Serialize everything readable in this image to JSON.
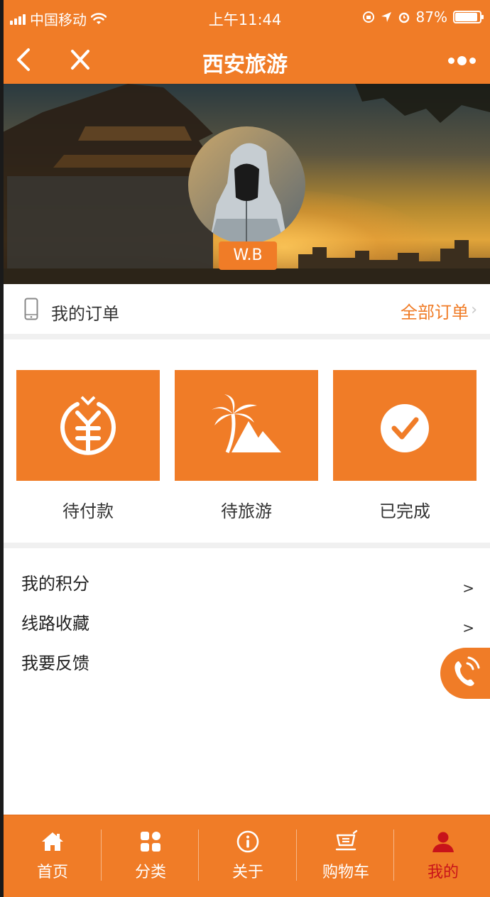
{
  "status_bar": {
    "carrier": "中国移动",
    "time": "上午11:44",
    "battery": "87%"
  },
  "nav": {
    "title": "西安旅游",
    "back_icon": "chevron-left-icon",
    "close_icon": "close-icon",
    "more_icon": "more-dots-icon"
  },
  "profile": {
    "username": "W.B"
  },
  "orders": {
    "label": "我的订单",
    "all_orders": "全部订单",
    "chevron": "›"
  },
  "order_status": [
    {
      "label": "待付款",
      "icon": "yuan-coin-icon"
    },
    {
      "label": "待旅游",
      "icon": "palm-tree-icon"
    },
    {
      "label": "已完成",
      "icon": "check-circle-icon"
    }
  ],
  "menu": [
    {
      "label": "我的积分",
      "arrow": ">"
    },
    {
      "label": "线路收藏",
      "arrow": ">"
    },
    {
      "label": "我要反馈"
    }
  ],
  "tabs": [
    {
      "label": "首页",
      "icon": "home-icon"
    },
    {
      "label": "分类",
      "icon": "grid-icon"
    },
    {
      "label": "关于",
      "icon": "info-icon"
    },
    {
      "label": "购物车",
      "icon": "cart-icon"
    },
    {
      "label": "我的",
      "icon": "user-icon",
      "active": true
    }
  ],
  "colors": {
    "brand": "#f07c27",
    "active_tab": "#c8131a"
  }
}
